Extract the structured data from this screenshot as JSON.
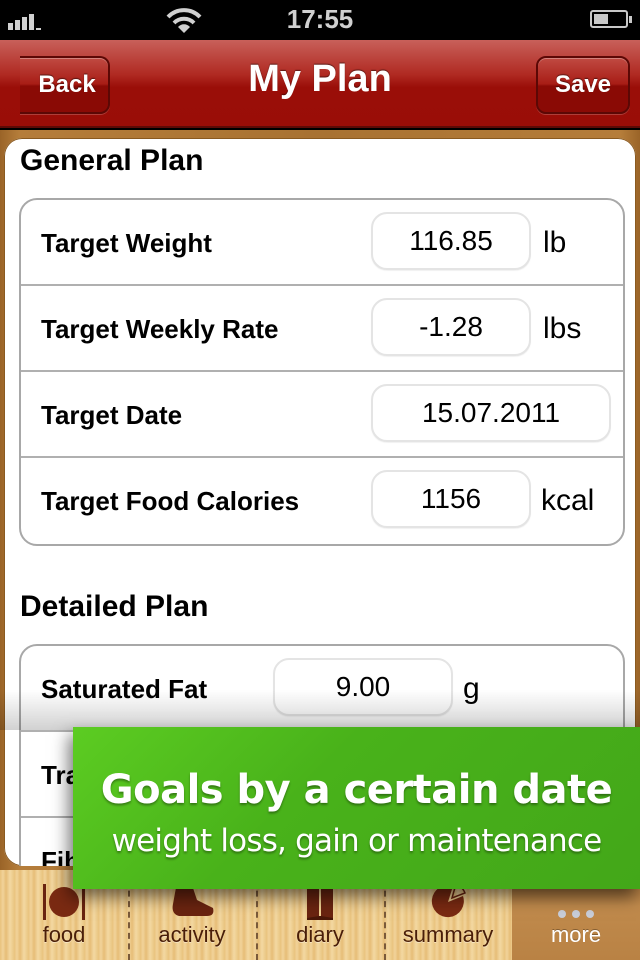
{
  "status_bar": {
    "time": "17:55",
    "signal_icon": "signal-bars-icon",
    "wifi_icon": "wifi-icon",
    "battery_icon": "battery-icon",
    "battery_level": 0.45
  },
  "nav_bar": {
    "title": "My Plan",
    "back_label": "Back",
    "save_label": "Save"
  },
  "general_plan": {
    "title": "General Plan",
    "rows": [
      {
        "label": "Target Weight",
        "value": "116.85",
        "unit": "lb"
      },
      {
        "label": "Target Weekly Rate",
        "value": "-1.28",
        "unit": "lbs"
      },
      {
        "label": "Target Date",
        "value": "15.07.2011",
        "unit": ""
      },
      {
        "label": "Target Food Calories",
        "value": "1156",
        "unit": "kcal"
      }
    ]
  },
  "detailed_plan": {
    "title": "Detailed Plan",
    "rows": [
      {
        "label": "Saturated Fat",
        "value": "9.00",
        "unit": "g"
      },
      {
        "label": "Tra",
        "value": "",
        "unit": ""
      },
      {
        "label": "Fib",
        "value": "",
        "unit": ""
      }
    ]
  },
  "banner": {
    "title": "Goals by a certain date",
    "subtitle": "weight loss, gain or maintenance",
    "color": "#4cb41c"
  },
  "tab_bar": {
    "active": "more",
    "tabs": [
      {
        "id": "food",
        "label": "food",
        "icon": "plate-fork-knife-icon"
      },
      {
        "id": "activity",
        "label": "activity",
        "icon": "shoe-icon"
      },
      {
        "id": "diary",
        "label": "diary",
        "icon": "book-icon"
      },
      {
        "id": "summary",
        "label": "summary",
        "icon": "pie-chart-icon"
      },
      {
        "id": "more",
        "label": "more",
        "icon": "more-dots-icon"
      }
    ]
  },
  "colors": {
    "nav_red": "#9a0e08",
    "tab_text": "#4a1e08",
    "wood": "#ecc886"
  }
}
